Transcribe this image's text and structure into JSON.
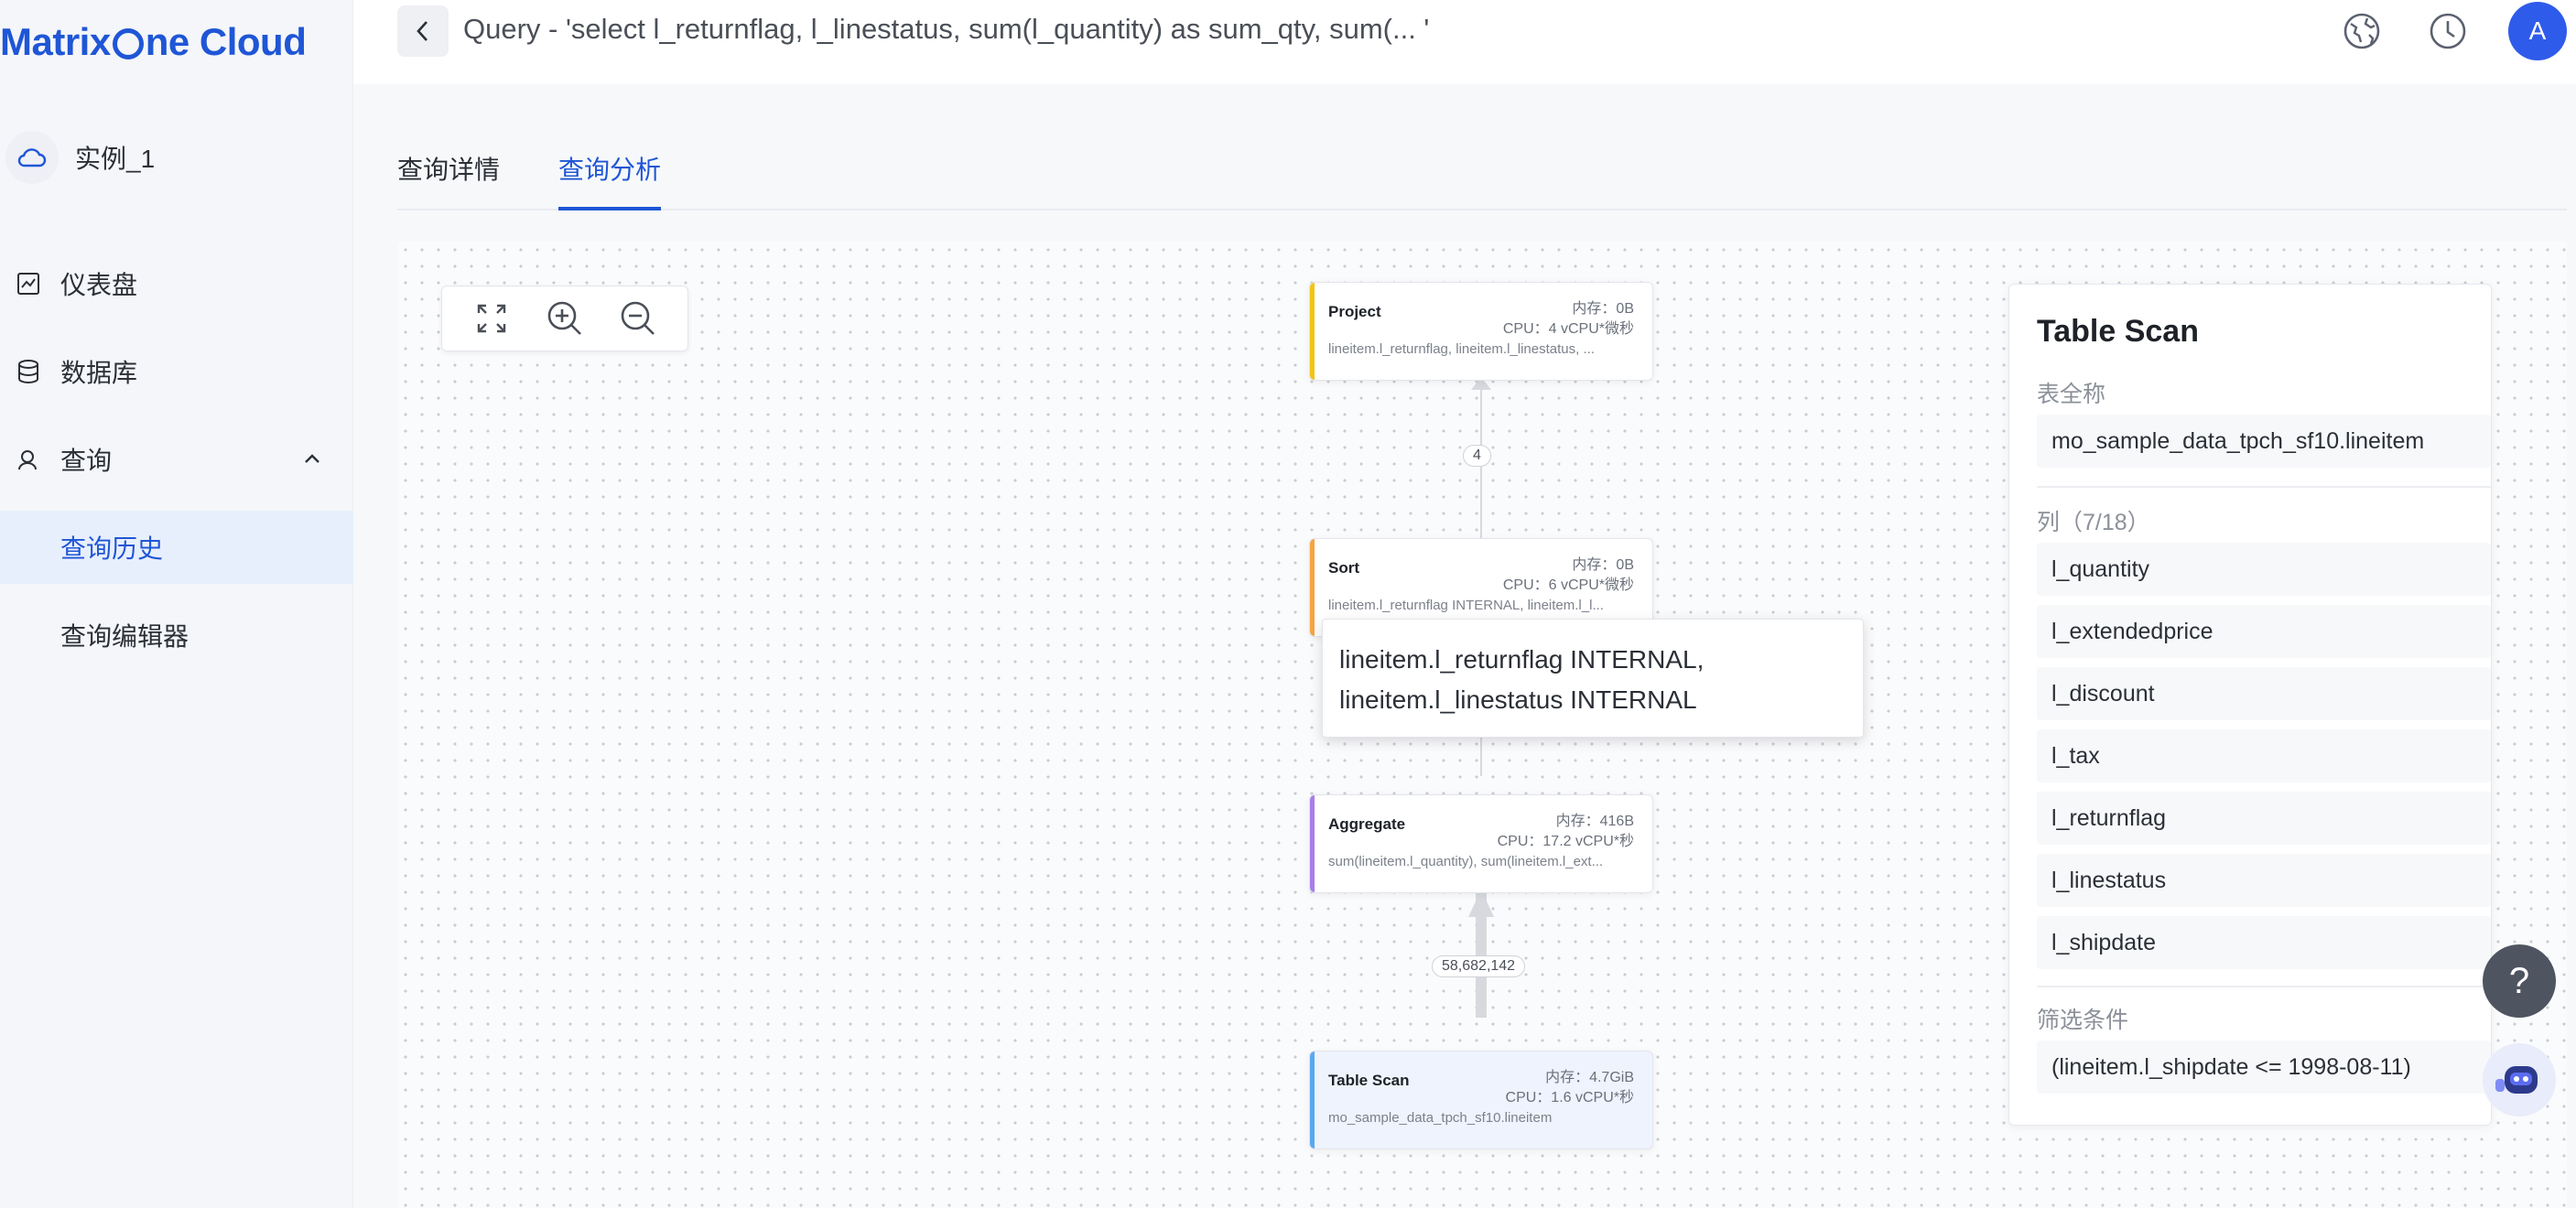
{
  "brand": {
    "logo_part1": "Matrix",
    "logo_part2": "ne Cloud",
    "color": "#1f56d6"
  },
  "sidebar": {
    "instance": "实例_1",
    "items": [
      {
        "label": "仪表盘",
        "icon": "chart-icon"
      },
      {
        "label": "数据库",
        "icon": "database-icon"
      },
      {
        "label": "查询",
        "icon": "search-user-icon",
        "expanded": true
      },
      {
        "label": "查询历史",
        "active": true
      },
      {
        "label": "查询编辑器"
      }
    ]
  },
  "header": {
    "query_title": "Query - 'select l_returnflag, l_linestatus, sum(l_quantity) as sum_qty, sum(... '",
    "avatar_initial": "A"
  },
  "tabs": [
    {
      "label": "查询详情",
      "active": false
    },
    {
      "label": "查询分析",
      "active": true
    }
  ],
  "plan": {
    "nodes": [
      {
        "name": "Project",
        "mem": "内存：0B",
        "cpu": "CPU：4 vCPU*微秒",
        "detail": "lineitem.l_returnflag, lineitem.l_linestatus, ...",
        "color": "#f2c417"
      },
      {
        "name": "Sort",
        "mem": "内存：0B",
        "cpu": "CPU：6 vCPU*微秒",
        "detail": "lineitem.l_returnflag INTERNAL, lineitem.l_l...",
        "color": "#f5a445"
      },
      {
        "name": "Aggregate",
        "mem": "内存：416B",
        "cpu": "CPU：17.2 vCPU*秒",
        "detail": "sum(lineitem.l_quantity), sum(lineitem.l_ext...",
        "color": "#a77ee8"
      },
      {
        "name": "Table Scan",
        "mem": "内存：4.7GiB",
        "cpu": "CPU：1.6 vCPU*秒",
        "detail": "mo_sample_data_tpch_sf10.lineitem",
        "color": "#5aa7f0"
      }
    ],
    "edges": [
      {
        "label": "4"
      },
      {
        "label": "58,682,142"
      }
    ],
    "tooltip": {
      "line1": "lineitem.l_returnflag INTERNAL,",
      "line2": "lineitem.l_linestatus INTERNAL"
    }
  },
  "panel": {
    "title": "Table Scan",
    "table_label": "表全称",
    "table_value": "mo_sample_data_tpch_sf10.lineitem",
    "columns_label": "列（7/18）",
    "columns": [
      "l_quantity",
      "l_extendedprice",
      "l_discount",
      "l_tax",
      "l_returnflag",
      "l_linestatus",
      "l_shipdate"
    ],
    "filter_label": "筛选条件",
    "filter_value": "(lineitem.l_shipdate <= 1998-08-11)"
  },
  "help_label": "?"
}
